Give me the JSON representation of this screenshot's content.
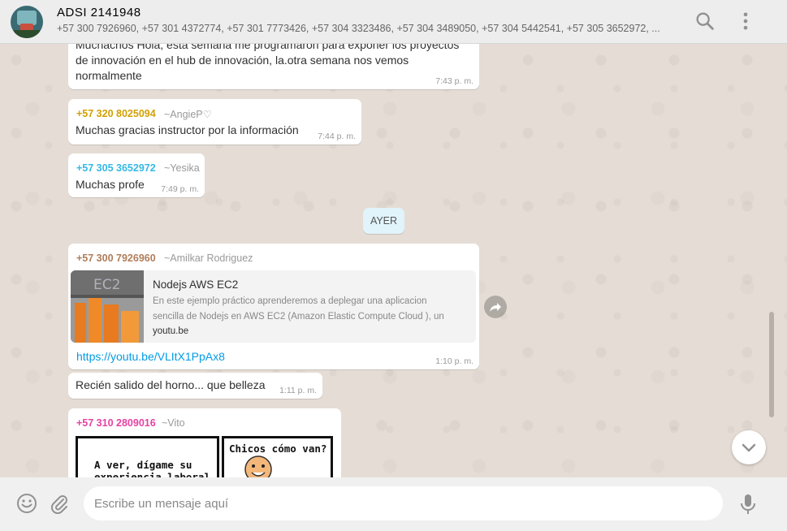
{
  "header": {
    "title": "ADSI 2141948",
    "participants": "+57 300 7926960, +57 301 4372774, +57 301 7773426, +57 304 3323486, +57 304 3489050, +57 304 5442541, +57 305 3652972, ...",
    "search_icon": "search-icon",
    "menu_icon": "more-vertical-icon"
  },
  "messages": [
    {
      "text": "Muchachos Hola, esta semana me programaron para exponer los proyectos de innovación en el hub de innovación, la.otra semana nos vemos normalmente",
      "lines": [
        "Muchachos Hola, esta semana me programaron para exponer los proyectos",
        "de innovación en el hub de innovación, la.otra semana nos vemos",
        "normalmente"
      ],
      "time": "7:43 p. m."
    },
    {
      "sender": "+57 320 8025094",
      "alias": "~AngieP♡",
      "sender_color": "#d3a000",
      "text": "Muchas gracias instructor por la información",
      "time": "7:44 p. m."
    },
    {
      "sender": "+57 305 3652972",
      "alias": "~Yesika",
      "sender_color": "#35b9e5",
      "text": "Muchas profe",
      "time": "7:49 p. m."
    },
    {
      "sender": "+57 300 7926960",
      "alias": "~Amilkar Rodriguez",
      "sender_color": "#b07d5a",
      "link_preview": {
        "title": "Nodejs AWS EC2",
        "description": "En este ejemplo práctico aprenderemos a deplegar una aplicacion sencilla de Nodejs en AWS EC2 (Amazon Elastic Compute Cloud ), un",
        "description_lines": [
          "En este ejemplo práctico aprenderemos a deplegar una aplicacion",
          "sencilla de Nodejs en AWS EC2 (Amazon Elastic Compute Cloud ), un"
        ],
        "domain": "youtu.be",
        "thumbnail_text": "EC2"
      },
      "link": "https://youtu.be/VLItX1PpAx8",
      "time": "1:10 p. m."
    },
    {
      "text": "Recién salido del horno... que belleza",
      "time": "1:11 p. m."
    },
    {
      "sender": "+57 310 2809016",
      "alias": "~Vito",
      "sender_color": "#e542a3",
      "image": {
        "panel1_lines": [
          "A ver, dígame su",
          "experiencia laboral"
        ],
        "panel2_text": "Chicos cómo van?"
      }
    }
  ],
  "date_divider": "AYER",
  "composer": {
    "placeholder": "Escribe un mensaje aquí",
    "emoji_icon": "emoji-icon",
    "attach_icon": "paperclip-icon",
    "mic_icon": "microphone-icon"
  },
  "colors": {
    "header_bg": "#ededed",
    "chat_bg": "#e5ddd5",
    "bubble_bg": "#ffffff",
    "link": "#039be5",
    "date_chip_bg": "#e1f3fb"
  }
}
